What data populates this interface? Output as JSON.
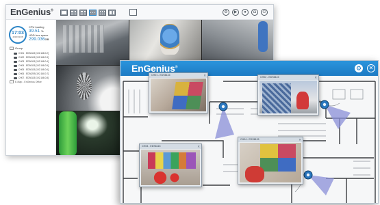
{
  "back_window": {
    "logo": "EnGenius",
    "clock": {
      "time": "17:03",
      "date": "2016/01/08"
    },
    "status": {
      "cpu_label": "CPU loading",
      "cpu_value": "39.51",
      "cpu_unit": "%",
      "hdd_label": "HDD free space",
      "hdd_value": "299.036",
      "hdd_unit": "GB"
    },
    "tree": {
      "root_label": "Group",
      "cameras": [
        "CH01 - EDS6115 [192.168.0.2]",
        "CH02 - EDS6115 [192.168.0.3]",
        "CH03 - EDS6115 [192.168.0.4]",
        "CH04 - EDS6115 [192.168.0.5]",
        "CH05 - EDS6115 [192.168.0.6]",
        "CH06 - EDS6255 [192.168.0.7]",
        "CH07 - EDS6115 [192.168.0.8]"
      ],
      "emap_label": "E-Map - EnGenius Office"
    },
    "layout_options": [
      "1x1",
      "2x2",
      "1+5",
      "3x3",
      "4x4",
      "1+7"
    ],
    "active_layout": "3x3",
    "control_icons": [
      "settings-icon",
      "playback-icon",
      "record-icon",
      "snapshot-icon",
      "logout-icon"
    ]
  },
  "front_window": {
    "logo": "EnGenius",
    "popups": [
      {
        "title": "CH01 - EDS6115"
      },
      {
        "title": "CH02 - EDS6115"
      },
      {
        "title": "CH03 - EDS6115"
      },
      {
        "title": "CH04 - EDS6115"
      }
    ]
  },
  "colors": {
    "brand_blue": "#1c7bc4",
    "accent_blue": "#2b84c6",
    "camera_fov": "#8a8fd8"
  }
}
